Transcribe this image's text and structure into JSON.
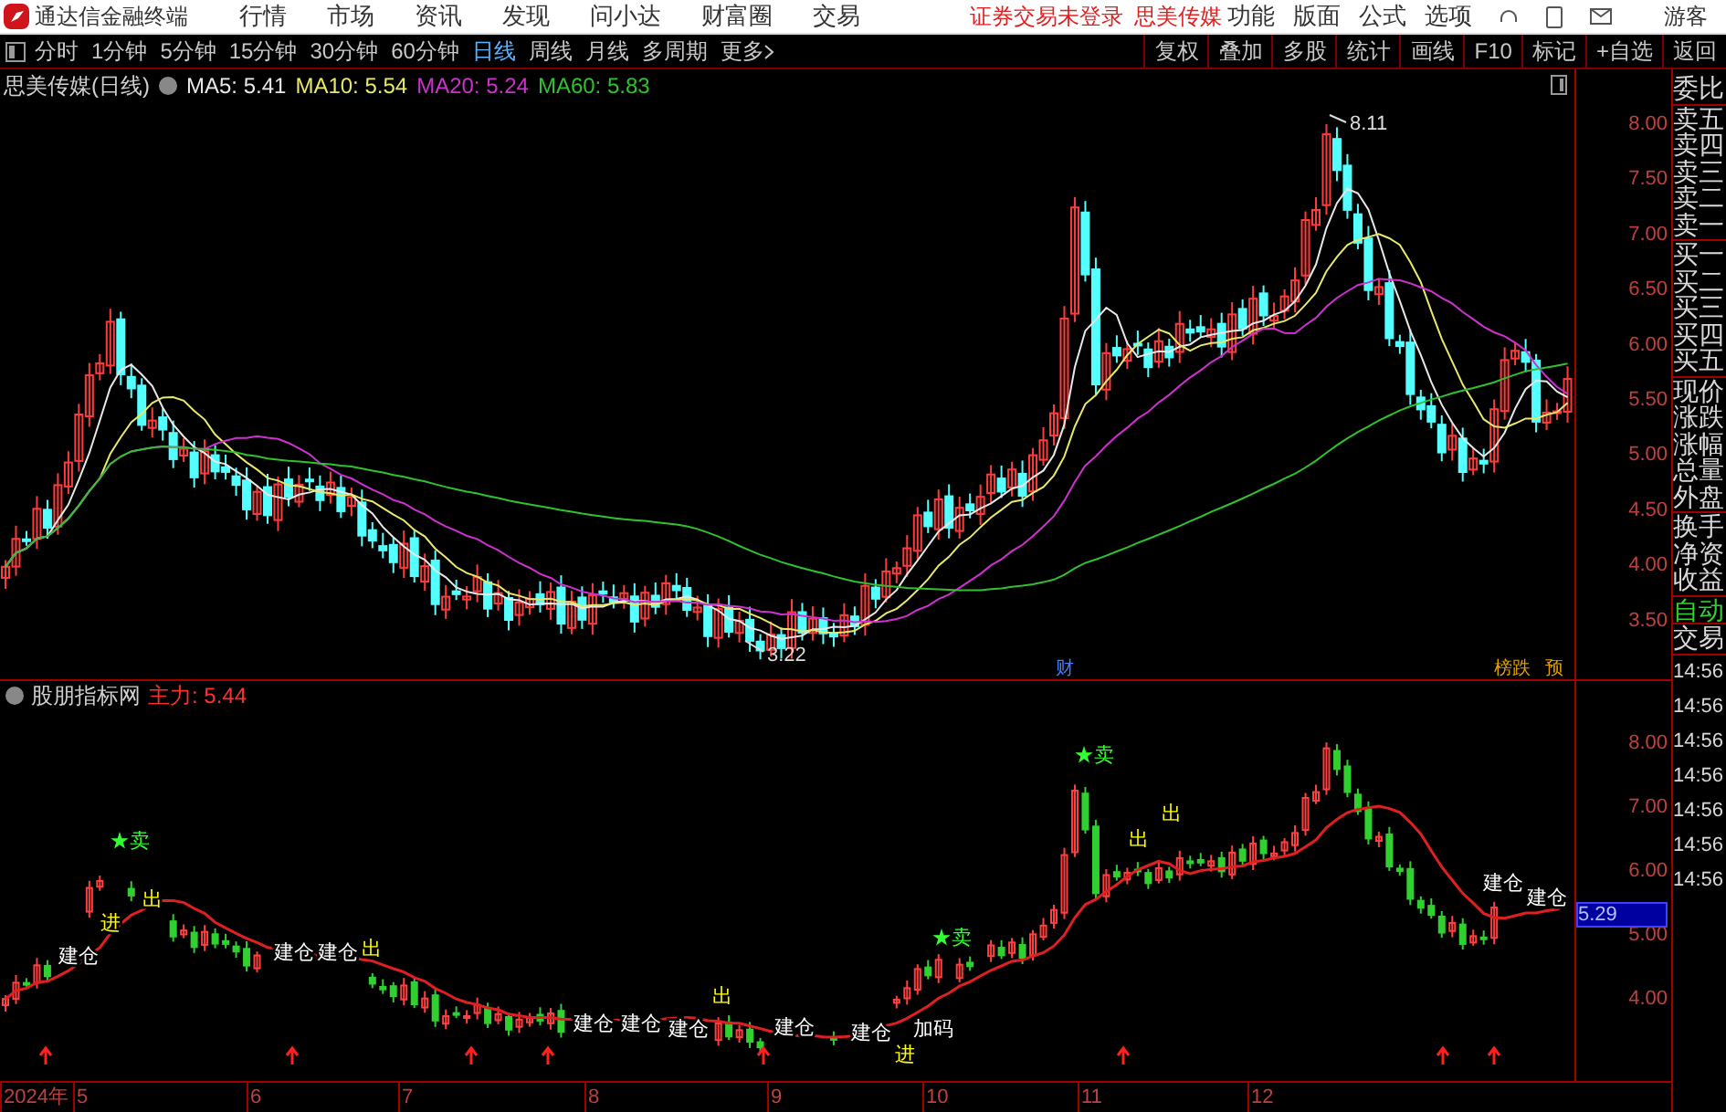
{
  "title_bar": {
    "app_name": "通达信金融终端",
    "menu": [
      "行情",
      "市场",
      "资讯",
      "发现",
      "问小达",
      "财富圈",
      "交易"
    ],
    "login_status": "证券交易未登录",
    "stock_name": "思美传媒",
    "tools": [
      "功能",
      "版面",
      "公式",
      "选项"
    ],
    "user": "游客"
  },
  "toolbar": {
    "periods": [
      {
        "label": "分时",
        "selected": false
      },
      {
        "label": "1分钟",
        "selected": false
      },
      {
        "label": "5分钟",
        "selected": false
      },
      {
        "label": "15分钟",
        "selected": false
      },
      {
        "label": "30分钟",
        "selected": false
      },
      {
        "label": "60分钟",
        "selected": false
      },
      {
        "label": "日线",
        "selected": true
      },
      {
        "label": "周线",
        "selected": false
      },
      {
        "label": "月线",
        "selected": false
      },
      {
        "label": "多周期",
        "selected": false
      }
    ],
    "more": "更多",
    "actions": [
      "复权",
      "叠加",
      "多股",
      "统计",
      "画线",
      "F10",
      "标记",
      "+自选",
      "返回"
    ]
  },
  "main_chart": {
    "title": "思美传媒(日线)",
    "indicators": [
      {
        "label": "MA5: 5.41",
        "color": "#e8e8e8"
      },
      {
        "label": "MA10: 5.54",
        "color": "#e8e86a"
      },
      {
        "label": "MA20: 5.24",
        "color": "#d030d0"
      },
      {
        "label": "MA60: 5.83",
        "color": "#30c030"
      }
    ],
    "yticks": [
      "8.00",
      "7.50",
      "7.00",
      "6.50",
      "6.00",
      "5.50",
      "5.00",
      "4.50",
      "4.00",
      "3.50"
    ],
    "high_label": "8.11",
    "low_label": "3.22",
    "badges": [
      {
        "text": "财",
        "color": "#4080ff"
      },
      {
        "text": "榜跌",
        "color": "#e0a000"
      },
      {
        "text": "预",
        "color": "#e0a000"
      }
    ]
  },
  "indicator_panel": {
    "title": "股朋指标网",
    "reading": "主力: 5.44",
    "yticks": [
      "8.00",
      "7.00",
      "6.00",
      "5.00",
      "4.00"
    ],
    "current_value": "5.29",
    "signals": [
      {
        "text": "建仓"
      },
      {
        "text": "进"
      },
      {
        "text": "★卖"
      },
      {
        "text": "出"
      },
      {
        "text": "建仓"
      },
      {
        "text": "建仓"
      },
      {
        "text": "出"
      },
      {
        "text": "建仓"
      },
      {
        "text": "建仓"
      },
      {
        "text": "建仓"
      },
      {
        "text": "出"
      },
      {
        "text": "建仓"
      },
      {
        "text": "建仓"
      },
      {
        "text": "进"
      },
      {
        "text": "加码"
      },
      {
        "text": "★卖"
      },
      {
        "text": "★卖"
      },
      {
        "text": "出"
      },
      {
        "text": "出"
      },
      {
        "text": "建仓"
      },
      {
        "text": "建仓"
      }
    ]
  },
  "time_axis": [
    "2024年",
    "5",
    "6",
    "7",
    "8",
    "9",
    "10",
    "11",
    "12"
  ],
  "quote_panel": {
    "groups": [
      [
        "委比"
      ],
      [
        "卖五",
        "卖四",
        "卖三",
        "卖二",
        "卖一"
      ],
      [
        "买一",
        "买二",
        "买三",
        "买四",
        "买五"
      ],
      [
        "现价",
        "涨跌",
        "涨幅",
        "总量",
        "外盘"
      ],
      [
        "换手",
        "净资",
        "收益"
      ]
    ],
    "auto_label": "自动",
    "trade_label": "交易",
    "times": [
      "14:56",
      "14:56",
      "14:56",
      "14:56",
      "14:56",
      "14:56",
      "14:56"
    ]
  }
}
